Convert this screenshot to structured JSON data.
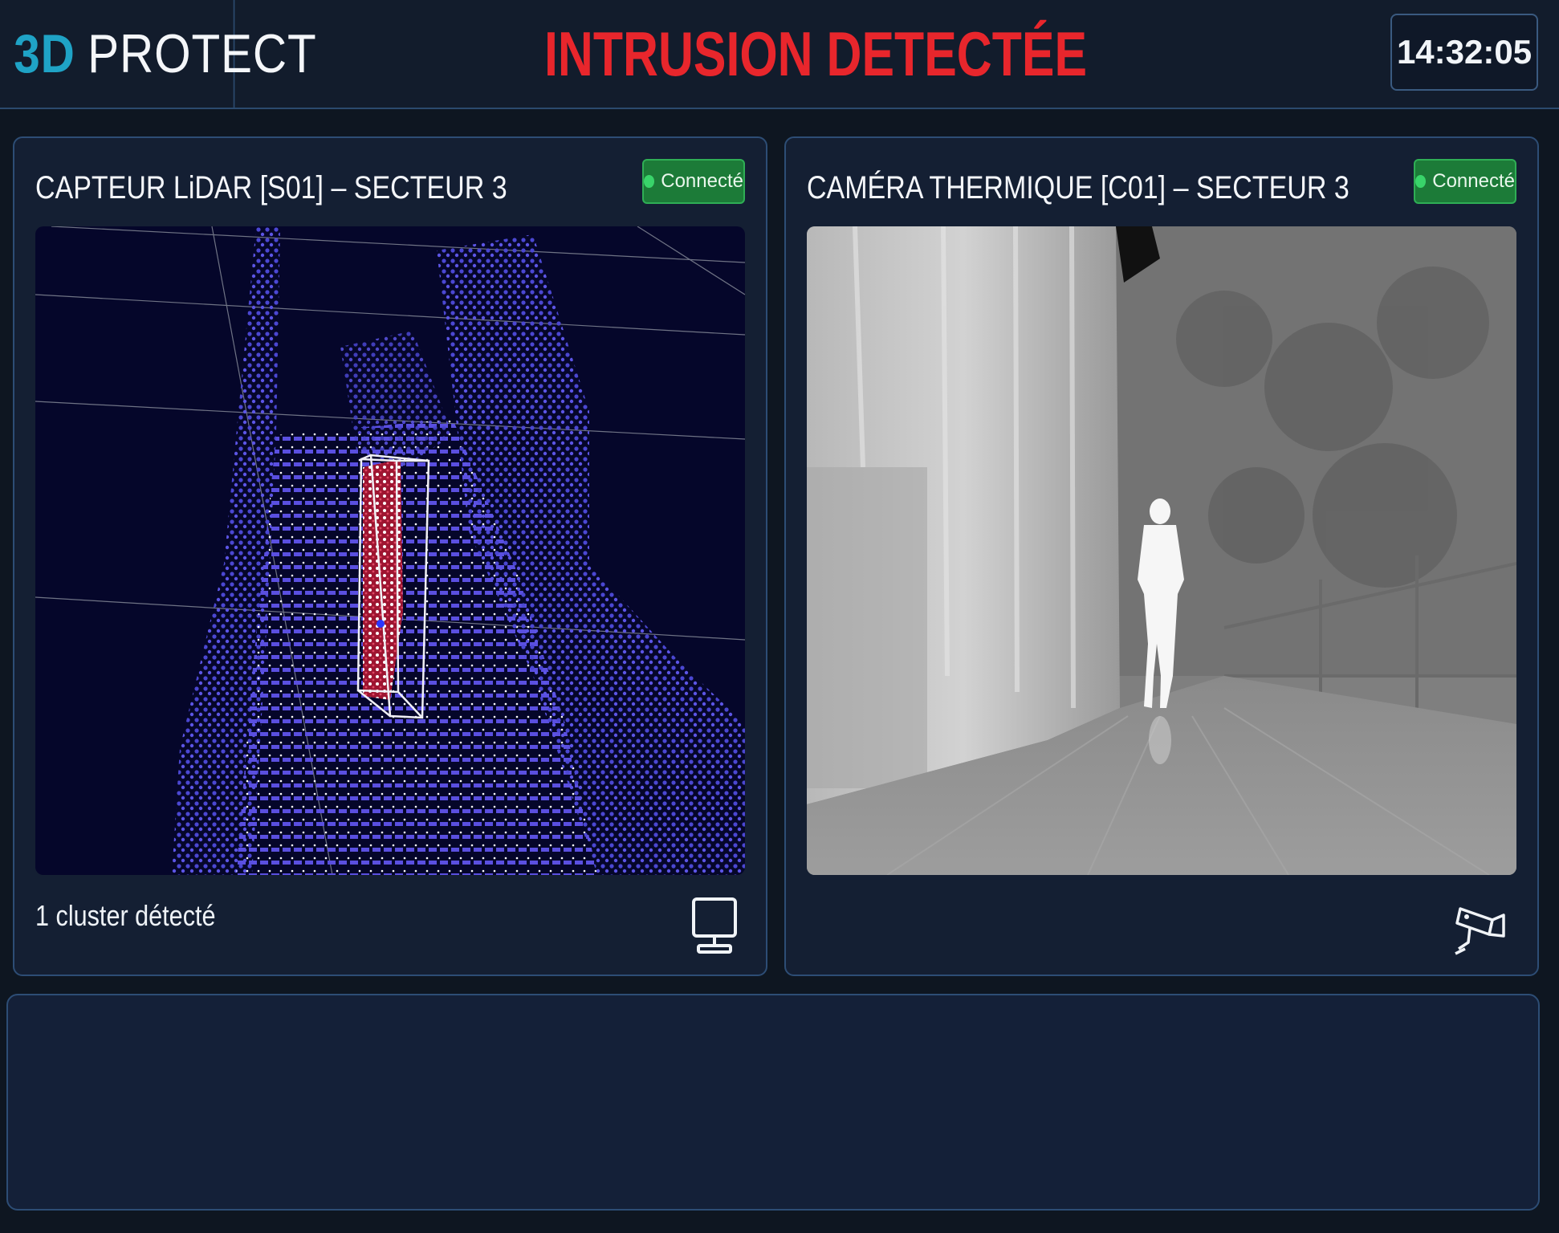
{
  "header": {
    "brand_part1": "3D",
    "brand_part2": "PROTECT",
    "alert_title": "INTRUSION DETECTÉE",
    "clock": "14:32:05"
  },
  "panels": [
    {
      "title": "CAPTEUR LiDAR [S01] – SECTEUR 3",
      "status": "Connecté",
      "footer": "1 cluster détecté",
      "icon": "monitor-icon"
    },
    {
      "title": "CAMÉRA THERMIQUE [C01] – SECTEUR 3",
      "status": "Connecté",
      "icon": "security-camera-icon"
    }
  ],
  "colors": {
    "alert": "#e8262c",
    "brand_accent": "#1fa3c6",
    "connected": "#1c7b38",
    "panel_border": "#2d4d75"
  }
}
